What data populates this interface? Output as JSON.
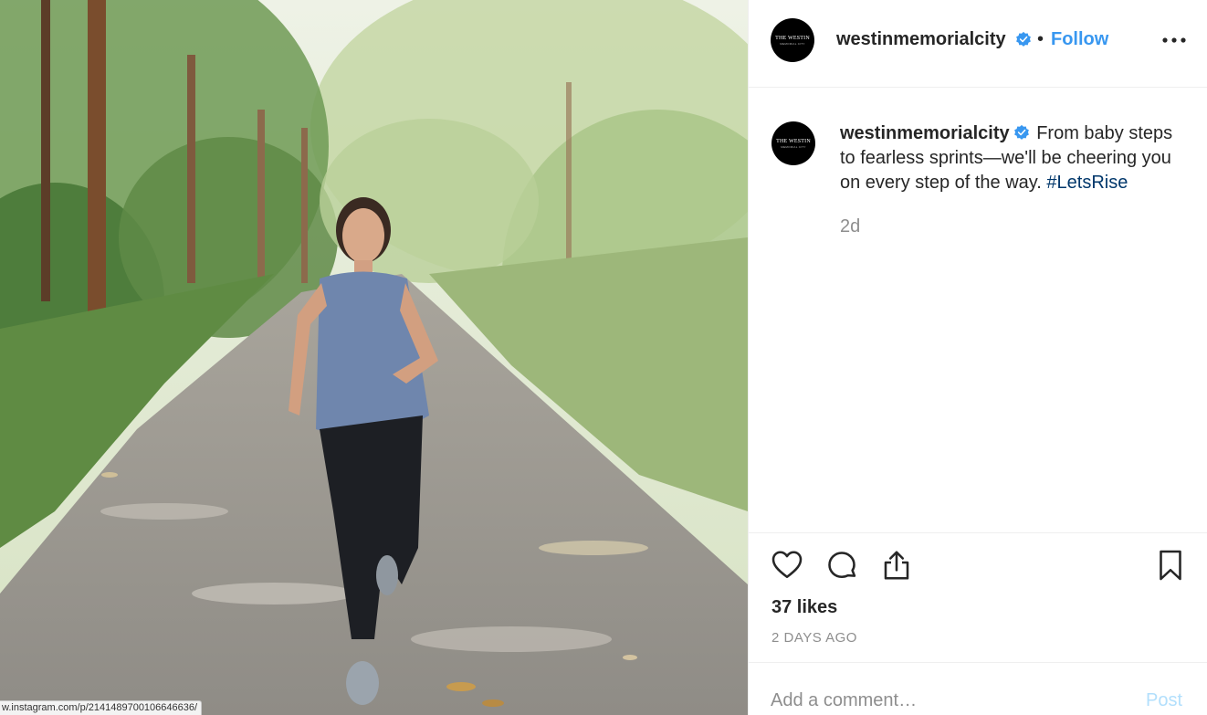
{
  "post": {
    "image_alt": "Woman jogging on a paved forest trail",
    "status_url": "w.instagram.com/p/2141489700106646636/"
  },
  "header": {
    "avatar_brand": "THE WESTIN",
    "avatar_sub": "MEMORIAL CITY",
    "username": "westinmemorialcity",
    "separator": "•",
    "follow_label": "Follow"
  },
  "caption": {
    "username": "westinmemorialcity",
    "text": "From baby steps to fearless sprints—we'll be cheering you on every step of the way. ",
    "hashtag": "#LetsRise",
    "time": "2d"
  },
  "actions": {
    "likes": "37 likes",
    "posted_ago": "2 DAYS AGO"
  },
  "comment": {
    "placeholder": "Add a comment…",
    "post_label": "Post"
  },
  "colors": {
    "follow": "#3897f0",
    "verified": "#3897f0",
    "hashtag": "#00376b",
    "post_disabled": "#b2dffc",
    "muted": "#8e8e8e"
  }
}
